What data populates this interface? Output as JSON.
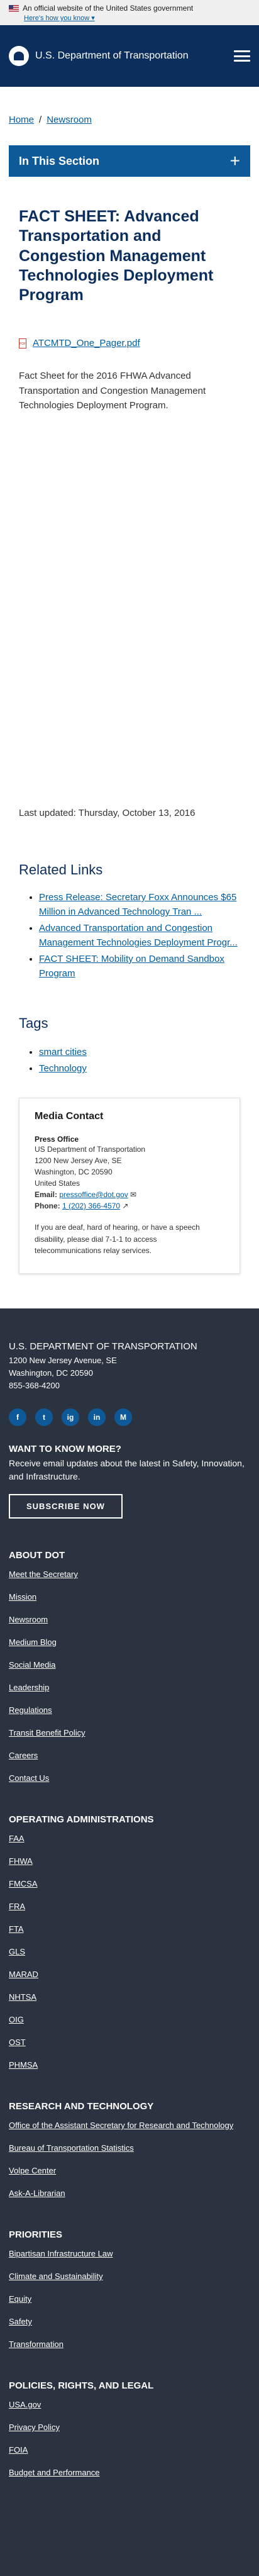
{
  "banner": {
    "official": "An official website of the United States government",
    "know": "Here's how you know"
  },
  "header": {
    "title": "U.S. Department of Transportation"
  },
  "breadcrumb": {
    "home": "Home",
    "separator": "/",
    "newsroom": "Newsroom"
  },
  "section": {
    "label": "In This Section",
    "toggle": "+"
  },
  "article": {
    "title": "FACT SHEET: Advanced Transportation and Congestion Management Technologies Deployment Program",
    "file": "ATCMTD_One_Pager.pdf",
    "summary": "Fact Sheet for the 2016 FHWA Advanced Transportation and Congestion Management Technologies Deployment Program.",
    "updated": "Last updated: Thursday, October 13, 2016"
  },
  "related": {
    "heading": "Related Links",
    "items": [
      "Press Release: Secretary Foxx Announces $65 Million in Advanced Technology Tran ...",
      "Advanced Transportation and Congestion Management Technologies Deployment Progr...",
      "FACT SHEET: Mobility on Demand Sandbox Program"
    ]
  },
  "tags": {
    "heading": "Tags",
    "items": [
      "smart cities",
      "Technology"
    ]
  },
  "media": {
    "heading": "Media Contact",
    "office": "Press Office",
    "lines": [
      "US Department of Transportation",
      "1200 New Jersey Ave, SE",
      "Washington, DC 20590",
      "United States"
    ],
    "email_label": "Email:",
    "email": "pressoffice@dot.gov",
    "phone_label": "Phone:",
    "phone": "1 (202) 366-4570",
    "deaf": "If you are deaf, hard of hearing, or have a speech disability, please dial 7-1-1 to access telecommunications relay services."
  },
  "footer": {
    "title": "U.S. DEPARTMENT OF TRANSPORTATION",
    "addr1": "1200 New Jersey Avenue, SE",
    "addr2": "Washington, DC 20590",
    "phone": "855-368-4200",
    "socials": [
      "f",
      "t",
      "ig",
      "in",
      "M"
    ],
    "want": "WANT TO KNOW MORE?",
    "want_desc": "Receive email updates about the latest in Safety, Innovation, and Infrastructure.",
    "subscribe": "SUBSCRIBE NOW",
    "about": {
      "heading": "ABOUT DOT",
      "links": [
        "Meet the Secretary",
        "Mission",
        "Newsroom",
        "Medium Blog",
        "Social Media",
        "Leadership",
        "Regulations",
        "Transit Benefit Policy",
        "Careers",
        "Contact Us"
      ]
    },
    "admins": {
      "heading": "OPERATING ADMINISTRATIONS",
      "links": [
        "FAA",
        "FHWA",
        "FMCSA",
        "FRA",
        "FTA",
        "GLS",
        "MARAD",
        "NHTSA",
        "OIG",
        "OST",
        "PHMSA"
      ]
    },
    "research": {
      "heading": "RESEARCH AND TECHNOLOGY",
      "links": [
        "Office of the Assistant Secretary for Research and Technology",
        "Bureau of Transportation Statistics",
        "Volpe Center",
        "Ask-A-Librarian"
      ]
    },
    "priorities": {
      "heading": "PRIORITIES",
      "links": [
        "Bipartisan Infrastructure Law",
        "Climate and Sustainability",
        "Equity",
        "Safety",
        "Transformation"
      ]
    },
    "policies": {
      "heading": "POLICIES, RIGHTS, AND LEGAL",
      "links": [
        "USA.gov",
        "Privacy Policy",
        "FOIA",
        "Budget and Performance"
      ]
    }
  }
}
